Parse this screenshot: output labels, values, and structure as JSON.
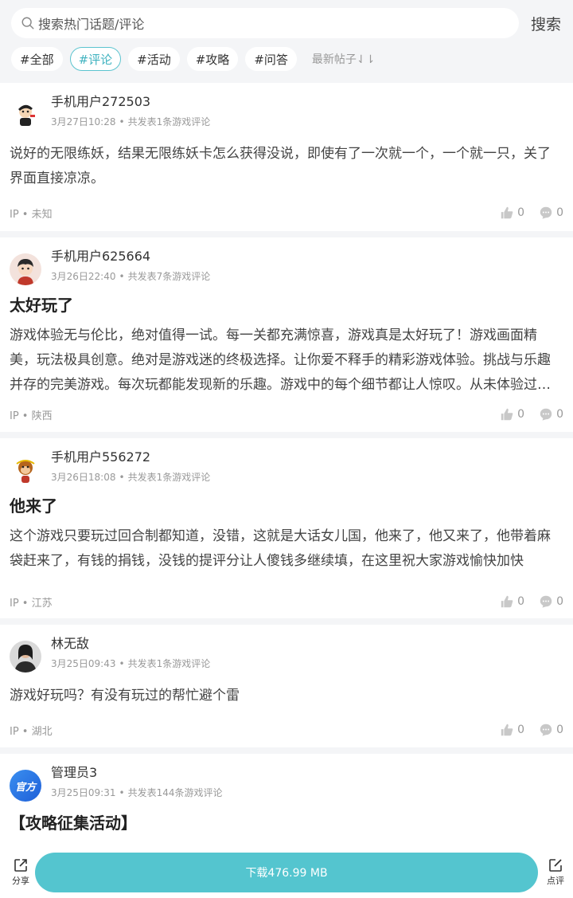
{
  "search": {
    "placeholder": "搜索热门话题/评论",
    "button": "搜索"
  },
  "tags": [
    "#全部",
    "#评论",
    "#活动",
    "#攻略",
    "#问答"
  ],
  "active_tag_index": 1,
  "sort_label": "最新帖子⇃⇂",
  "posts": [
    {
      "user": "手机用户272503",
      "time": "3月27日10:28",
      "count": "共发表1条游戏评论",
      "title": "",
      "body": "说好的无限练妖，结果无限练妖卡怎么获得没说，即使有了一次就一个，一个就一只，关了界面直接凉凉。",
      "ip": "IP • 未知",
      "likes": "0",
      "comments": "0"
    },
    {
      "user": "手机用户625664",
      "time": "3月26日22:40",
      "count": "共发表7条游戏评论",
      "title": "太好玩了",
      "body": "游戏体验无与伦比，绝对值得一试。每一关都充满惊喜，游戏真是太好玩了！游戏画面精美，玩法极具创意。绝对是游戏迷的终极选择。让你爱不释手的精彩游戏体验。挑战与乐趣并存的完美游戏。每次玩都能发现新的乐趣。游戏中的每个细节都让人惊叹。从未体验过如此精彩的游戏。",
      "ip": "IP • 陕西",
      "likes": "0",
      "comments": "0"
    },
    {
      "user": "手机用户556272",
      "time": "3月26日18:08",
      "count": "共发表1条游戏评论",
      "title": "他来了",
      "body": "这个游戏只要玩过回合制都知道，没错，这就是大话女儿国，他来了，他又来了，他带着麻袋赶来了，有钱的捐钱，没钱的提评分让人傻钱多继续填，在这里祝大家游戏愉快加快",
      "ip": "IP • 江苏",
      "likes": "0",
      "comments": "0"
    },
    {
      "user": "林无敌",
      "time": "3月25日09:43",
      "count": "共发表1条游戏评论",
      "title": "",
      "body": "游戏好玩吗？有没有玩过的帮忙避个雷",
      "ip": "IP • 湖北",
      "likes": "0",
      "comments": "0"
    },
    {
      "user": "管理员3",
      "time": "3月25日09:31",
      "count": "共发表144条游戏评论",
      "title": "【攻略征集活动】",
      "avatar_text": "官方"
    }
  ],
  "bottom": {
    "share": "分享",
    "download": "下载476.99 MB",
    "review": "点评"
  },
  "colors": {
    "accent": "#54c5cf",
    "background": "#f4f5f7"
  }
}
